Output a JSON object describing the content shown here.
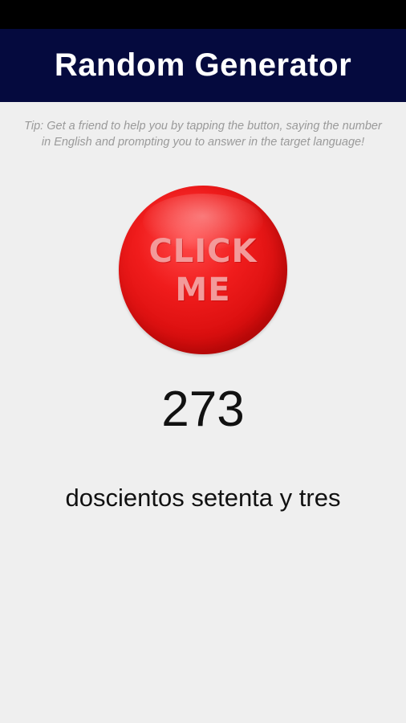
{
  "app": {
    "title": "Random Generator",
    "tip": "Tip: Get a friend to help you by tapping the button, saying the number in English and prompting you to answer in the target language!"
  },
  "button": {
    "line1": "CLICK",
    "line2": "ME"
  },
  "result": {
    "number": "273",
    "words": "doscientos setenta y tres"
  },
  "colors": {
    "app_bar": "#050a3e",
    "button": "#e01414",
    "background": "#efefef"
  }
}
